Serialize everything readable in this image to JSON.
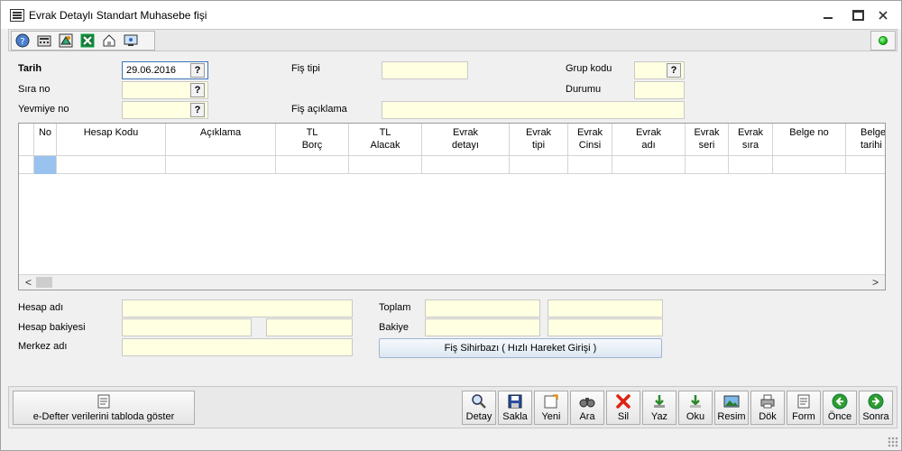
{
  "window": {
    "title": "Evrak Detaylı Standart Muhasebe fişi"
  },
  "toolbar": {
    "icons": [
      "help-icon",
      "calculator-icon",
      "settings-icon",
      "excel-icon",
      "home-icon",
      "screen-icon"
    ],
    "status_color": "#22aa22"
  },
  "form": {
    "tarih_label": "Tarih",
    "tarih_value": "29.06.2016",
    "sira_label": "Sıra no",
    "sira_value": "",
    "yevmiye_label": "Yevmiye no",
    "yevmiye_value": "",
    "fis_tipi_label": "Fiş tipi",
    "fis_tipi_value": "",
    "fis_aciklama_label": "Fiş açıklama",
    "fis_aciklama_value": "",
    "grup_kodu_label": "Grup kodu",
    "grup_kodu_value": "",
    "durumu_label": "Durumu",
    "durumu_value": "",
    "lookup_symbol": "?"
  },
  "grid": {
    "columns": [
      {
        "key": "no",
        "label": "No"
      },
      {
        "key": "hesap_kodu",
        "label": "Hesap Kodu"
      },
      {
        "key": "aciklama",
        "label": "Açıklama"
      },
      {
        "key": "tl_borc",
        "label": "TL\nBorç"
      },
      {
        "key": "tl_alacak",
        "label": "TL\nAlacak"
      },
      {
        "key": "evrak_detayi",
        "label": "Evrak\ndetayı"
      },
      {
        "key": "evrak_tipi",
        "label": "Evrak\ntipi"
      },
      {
        "key": "evrak_cinsi",
        "label": "Evrak\nCinsi"
      },
      {
        "key": "evrak_adi",
        "label": "Evrak\nadı"
      },
      {
        "key": "evrak_seri",
        "label": "Evrak\nseri"
      },
      {
        "key": "evrak_sira",
        "label": "Evrak\nsıra"
      },
      {
        "key": "belge_no",
        "label": "Belge no"
      },
      {
        "key": "belge_tarihi",
        "label": "Belge\ntarihi"
      }
    ],
    "rows": [
      [
        "",
        "",
        "",
        "",
        "",
        "",
        "",
        "",
        "",
        "",
        "",
        "",
        ""
      ]
    ],
    "scroll_left": "<",
    "scroll_right": ">"
  },
  "summary": {
    "hesap_adi_label": "Hesap adı",
    "hesap_bakiyesi_label": "Hesap bakiyesi",
    "merkez_adi_label": "Merkez adı",
    "toplam_label": "Toplam",
    "bakiye_label": "Bakiye",
    "hesap_adi_value": "",
    "hesap_bakiyesi_value_1": "",
    "hesap_bakiyesi_value_2": "",
    "merkez_adi_value": "",
    "toplam_borc": "",
    "toplam_alacak": "",
    "bakiye_borc": "",
    "bakiye_alacak": "",
    "wizard_button": "Fiş Sihirbazı ( Hızlı Hareket Girişi )"
  },
  "bottom": {
    "edefter_button": "e-Defter verilerini tabloda göster",
    "actions": [
      {
        "key": "detay",
        "label": "Detay",
        "icon": "magnifier-icon"
      },
      {
        "key": "sakla",
        "label": "Sakla",
        "icon": "save-icon"
      },
      {
        "key": "yeni",
        "label": "Yeni",
        "icon": "new-icon"
      },
      {
        "key": "ara",
        "label": "Ara",
        "icon": "binoculars-icon"
      },
      {
        "key": "sil",
        "label": "Sil",
        "icon": "delete-icon"
      },
      {
        "key": "yaz",
        "label": "Yaz",
        "icon": "write-icon"
      },
      {
        "key": "oku",
        "label": "Oku",
        "icon": "read-icon"
      },
      {
        "key": "resim",
        "label": "Resim",
        "icon": "picture-icon"
      },
      {
        "key": "dok",
        "label": "Dök",
        "icon": "printer-icon"
      },
      {
        "key": "form",
        "label": "Form",
        "icon": "form-icon"
      },
      {
        "key": "once",
        "label": "Önce",
        "icon": "previous-icon"
      },
      {
        "key": "sonra",
        "label": "Sonra",
        "icon": "next-icon"
      }
    ]
  }
}
